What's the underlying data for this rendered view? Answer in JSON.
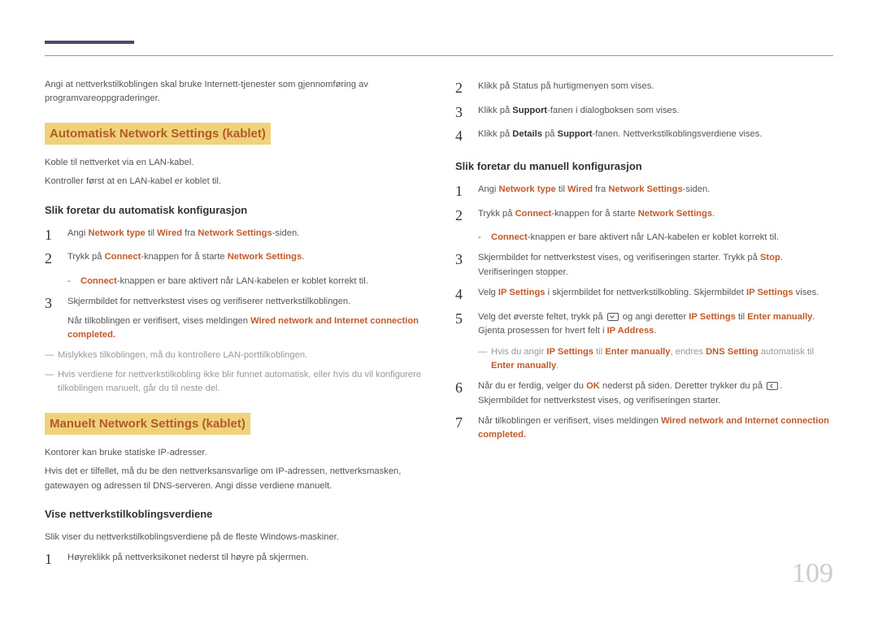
{
  "page_number": "109",
  "left": {
    "intro": "Angi at nettverkstilkoblingen skal bruke Internett-tjenester som gjennomføring av programvareoppgraderinger.",
    "h1": "Automatisk Network Settings  (kablet)",
    "p1": "Koble til nettverket via en LAN-kabel.",
    "p2": "Kontroller først at en LAN-kabel er koblet til.",
    "sh1": "Slik foretar du automatisk konfigurasjon",
    "s1_a": "Angi ",
    "s1_nt": "Network type",
    "s1_b": " til ",
    "s1_w": "Wired",
    "s1_c": " fra ",
    "s1_ns": "Network Settings",
    "s1_d": "-siden.",
    "s2_a": "Trykk på ",
    "s2_con": "Connect",
    "s2_b": "-knappen for å starte ",
    "s2_ns": "Network Settings",
    "s2_c": ".",
    "sb1_con": "Connect",
    "sb1": "-knappen er bare aktivert når LAN-kabelen er koblet korrekt til.",
    "s3": "Skjermbildet for nettverkstest vises og verifiserer nettverkstilkoblingen.",
    "s3b_a": "Når tilkoblingen er verifisert, vises meldingen ",
    "s3b_msg": "Wired network and Internet connection completed.",
    "note1": "Mislykkes tilkoblingen, må du kontrollere LAN-porttilkoblingen.",
    "note2": "Hvis verdiene for nettverkstilkobling ikke blir funnet automatisk, eller hvis du vil konfigurere tilkoblingen manuelt, går du til neste del.",
    "h2": "Manuelt Network Settings (kablet)",
    "p3": "Kontorer kan bruke statiske IP-adresser.",
    "p4": "Hvis det er tilfellet, må du be den nettverksansvarlige om IP-adressen, nettverksmasken, gatewayen og adressen til DNS-serveren. Angi disse verdiene manuelt.",
    "sh2": "Vise nettverkstilkoblingsverdiene",
    "p5": "Slik viser du nettverkstilkoblingsverdiene på de fleste Windows-maskiner.",
    "s4": "Høyreklikk på nettverksikonet nederst til høyre på skjermen."
  },
  "right": {
    "s2": "Klikk på Status på hurtigmenyen som vises.",
    "s3_a": "Klikk på ",
    "s3_sup": "Support",
    "s3_b": "-fanen i dialogboksen som vises.",
    "s4_a": "Klikk på ",
    "s4_det": "Details",
    "s4_b": " på ",
    "s4_sup": "Support",
    "s4_c": "-fanen. Nettverkstilkoblingsverdiene vises.",
    "sh1": "Slik foretar du manuell konfigurasjon",
    "m1_a": "Angi ",
    "m1_nt": "Network type",
    "m1_b": " til ",
    "m1_w": "Wired",
    "m1_c": " fra ",
    "m1_ns": "Network Settings",
    "m1_d": "-siden.",
    "m2_a": "Trykk på ",
    "m2_con": "Connect",
    "m2_b": "-knappen for å starte ",
    "m2_ns": "Network Settings",
    "m2_c": ".",
    "msb1_con": "Connect",
    "msb1": "-knappen er bare aktivert når LAN-kabelen er koblet korrekt til.",
    "m3_a": "Skjermbildet for nettverkstest vises, og verifiseringen starter. Trykk på ",
    "m3_stop": "Stop",
    "m3_b": ". Verifiseringen stopper.",
    "m4_a": "Velg ",
    "m4_ip": "IP Settings",
    "m4_b": " i skjermbildet for nettverkstilkobling. Skjermbildet ",
    "m4_ip2": "IP Settings",
    "m4_c": " vises.",
    "m5_a": "Velg det øverste feltet, trykk på ",
    "m5_b": " og angi deretter ",
    "m5_ip": "IP Settings",
    "m5_c": " til ",
    "m5_em": "Enter manually",
    "m5_d": ". Gjenta prosessen for hvert felt i ",
    "m5_ipa": "IP Address",
    "m5_e": ".",
    "mnote_a": "Hvis du angir ",
    "mnote_ip": "IP Settings",
    "mnote_b": " til ",
    "mnote_em": "Enter manually",
    "mnote_c": ", endres ",
    "mnote_dns": "DNS Setting",
    "mnote_d": " automatisk til ",
    "mnote_em2": "Enter manually",
    "mnote_e": ".",
    "m6_a": "Når du er ferdig, velger du ",
    "m6_ok": "OK",
    "m6_b": " nederst på siden. Deretter trykker du på ",
    "m6_c": ". Skjermbildet for nettverkstest vises, og verifiseringen starter.",
    "m7_a": "Når tilkoblingen er verifisert, vises meldingen ",
    "m7_msg": "Wired network and Internet connection completed."
  }
}
